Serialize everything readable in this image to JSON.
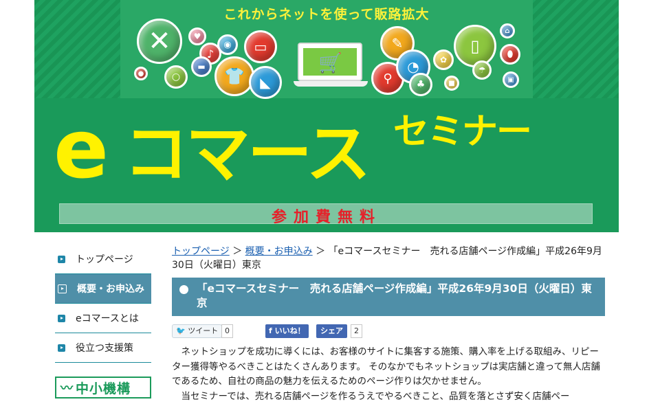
{
  "banner": {
    "tagline": "これからネットを使って販路拡大",
    "title_e": "e",
    "title_main": "コマース",
    "title_sub": "セミナー",
    "fee": "参加費無料",
    "icons": [
      "close-icon",
      "heart-icon",
      "music-icon",
      "camera-icon",
      "tv-icon",
      "tshirt-icon",
      "boot-icon",
      "ring-icon",
      "bicycle-icon",
      "pen-icon",
      "gauge-icon",
      "tablet-icon",
      "home-icon",
      "ball-icon",
      "umbrella-icon",
      "ribbon-icon",
      "tree-icon",
      "lock-icon"
    ]
  },
  "sidebar": {
    "items": [
      {
        "label": "トップページ",
        "active": false
      },
      {
        "label": "概要・お申込み",
        "active": true
      },
      {
        "label": "eコマースとは",
        "active": false
      },
      {
        "label": "役立つ支援策",
        "active": false
      }
    ],
    "logo_text": "中小機構"
  },
  "breadcrumb": {
    "home": "トップページ",
    "sep": "＞",
    "overview": "概要・お申込み",
    "current": "「eコマースセミナー　売れる店舗ページ作成編」平成26年9月30日（火曜日）東京"
  },
  "heading": "「eコマースセミナー　売れる店舗ページ作成編」平成26年9月30日（火曜日）東京",
  "social": {
    "tweet_label": "ツイート",
    "tweet_count": "0",
    "like_label": "いいね！",
    "share_label": "シェア",
    "share_count": "2"
  },
  "body": {
    "p1": "ネットショップを成功に導くには、お客様のサイトに集客する施策、購入率を上げる取組み、リピーター獲得等やるべきことはたくさんあります。 そのなかでもネットショップは実店舗と違って無人店舗であるため、自社の商品の魅力を伝えるためのページ作りは欠かせません。",
    "p2": "当セミナーでは、売れる店舗ページを作るうえでやるべきこと、品質を落とさず安く店舗ペー"
  },
  "colors": {
    "banner_green": "#1a9a5a",
    "title_yellow": "#fff200",
    "accent_blue": "#4f8fa8",
    "fee_red": "#e5212a"
  }
}
